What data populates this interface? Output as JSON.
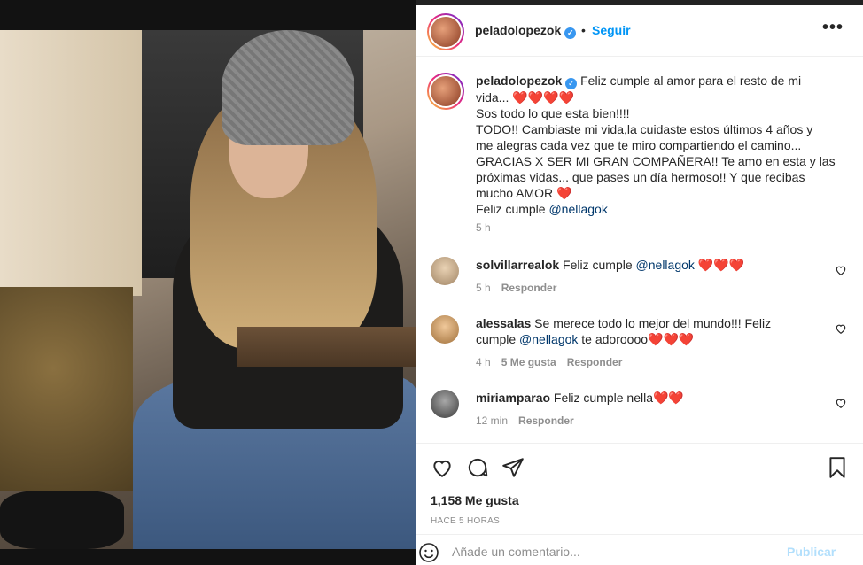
{
  "post": {
    "username": "peladolopezok",
    "follow_label": "Seguir",
    "dot": "•",
    "more_label": "•••",
    "caption": {
      "line1": " Feliz cumple al amor para el resto de mi",
      "line2": "vida... ❤️❤️❤️❤️",
      "line3": "Sos todo lo que esta bien!!!!",
      "line4": "TODO!! Cambiaste mi vida,la cuidaste estos últimos 4 años y",
      "line5": "me alegras cada vez que te miro compartiendo el camino...",
      "line6": "GRACIAS X SER MI GRAN COMPAÑERA!! Te amo en esta y las",
      "line7": "próximas vidas... que pases un día hermoso!! Y que recibas",
      "line8": "mucho AMOR ❤️",
      "line9_prefix": "Feliz cumple ",
      "line9_mention": "@nellagok",
      "time": "5 h"
    },
    "comments": [
      {
        "user": "solvillarrealok",
        "text_before": " Feliz cumple ",
        "mention": "@nellagok",
        "text_after": " ❤️❤️❤️",
        "time": "5 h",
        "likes": "",
        "reply": "Responder"
      },
      {
        "user": "alessalas",
        "text_line1": " Se merece todo lo mejor del mundo!!! Feliz",
        "text_line2_before": "cumple ",
        "mention": "@nellagok",
        "text_after": " te adoroooo❤️❤️❤️",
        "time": "4 h",
        "likes": "5 Me gusta",
        "reply": "Responder"
      },
      {
        "user": "miriamparao",
        "text": " Feliz cumple nella❤️❤️",
        "time": "12 min",
        "likes": "",
        "reply": "Responder"
      }
    ],
    "likes_count": "1,158 Me gusta",
    "posted_ago": "HACE 5 HORAS",
    "comment_placeholder": "Añade un comentario...",
    "publish_label": "Publicar"
  },
  "colors": {
    "link_blue": "#0095f6",
    "mention_blue": "#00376b",
    "publish_disabled": "#b2dffc",
    "muted": "#8e8e8e"
  },
  "icons": [
    "heart-icon",
    "comment-icon",
    "share-icon",
    "bookmark-icon",
    "emoji-icon",
    "verified-icon",
    "more-icon"
  ]
}
